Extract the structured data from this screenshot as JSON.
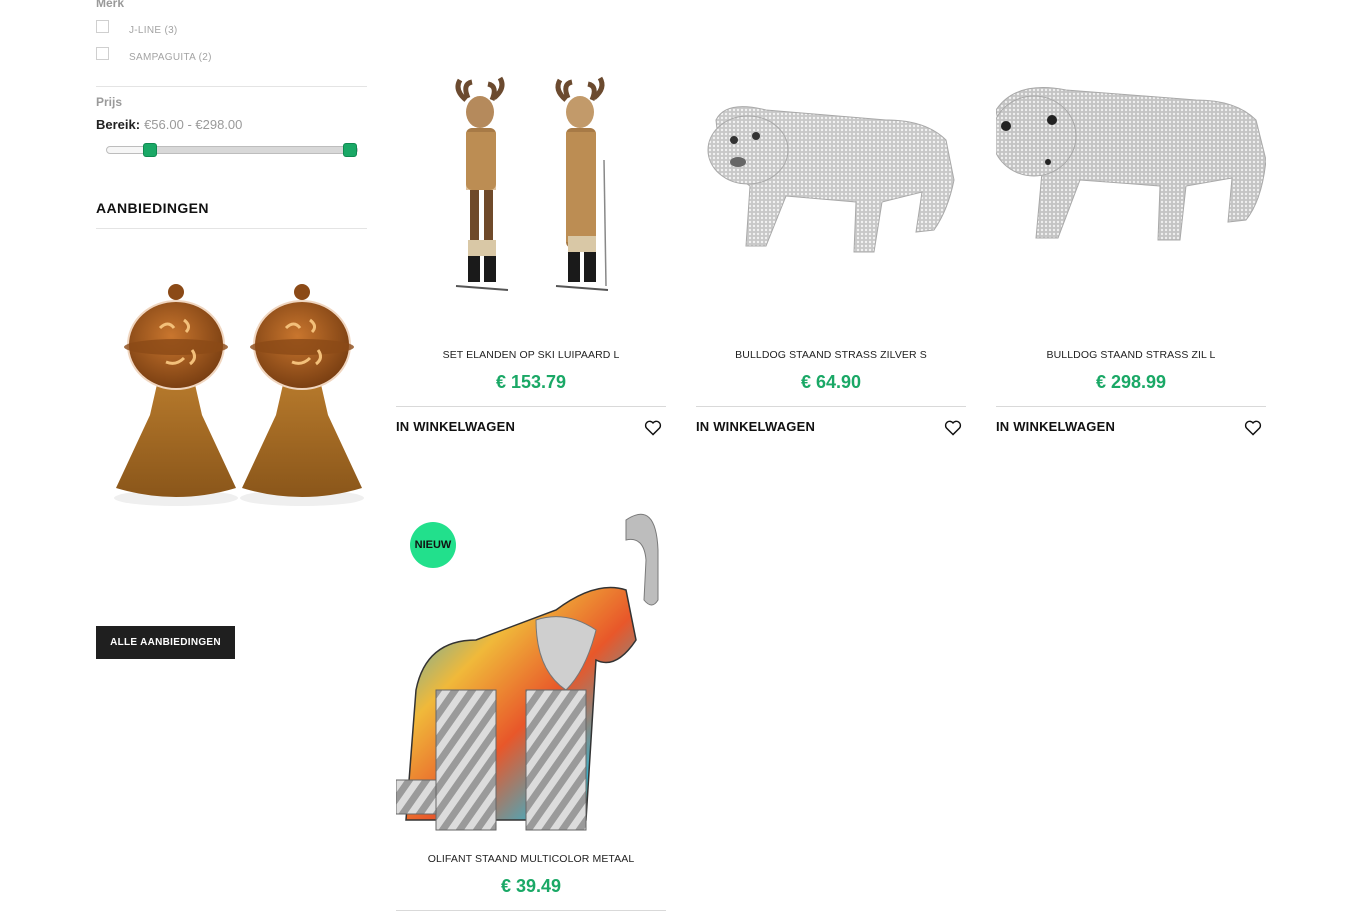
{
  "filters": {
    "brand": {
      "title": "Merk",
      "options": [
        {
          "label": "J-LINE (3)",
          "checked": false
        },
        {
          "label": "SAMPAGUITA (2)",
          "checked": false
        }
      ]
    },
    "price": {
      "title": "Prijs",
      "range_label": "Bereik:",
      "range_value": "€56.00 - €298.00",
      "slider": {
        "min_fraction": 0.18,
        "max_fraction": 1.0,
        "accent": "#1aa866"
      }
    }
  },
  "offers": {
    "heading": "AANBIEDINGEN",
    "image_icon": "lantern-pair-image",
    "button_label": "ALLE AANBIEDINGEN"
  },
  "products": [
    {
      "name": "SET ELANDEN OP SKI LUIPAARD L",
      "price": "€ 153.79",
      "cart_label": "IN WINKELWAGEN",
      "image": "moose-pair-image"
    },
    {
      "name": "BULLDOG STAAND STRASS ZILVER S",
      "price": "€ 64.90",
      "cart_label": "IN WINKELWAGEN",
      "image": "silver-bulldog-image"
    },
    {
      "name": "BULLDOG STAAND STRASS ZIL L",
      "price": "€ 298.99",
      "cart_label": "IN WINKELWAGEN",
      "image": "silver-bulldog-large-image"
    },
    {
      "name": "OLIFANT STAAND MULTICOLOR METAAL",
      "price": "€ 39.49",
      "badge": "NIEUW",
      "image": "elephant-metal-image"
    }
  ],
  "colors": {
    "price": "#1aa866",
    "badge": "#22e08c",
    "button": "#1f1f1f"
  }
}
